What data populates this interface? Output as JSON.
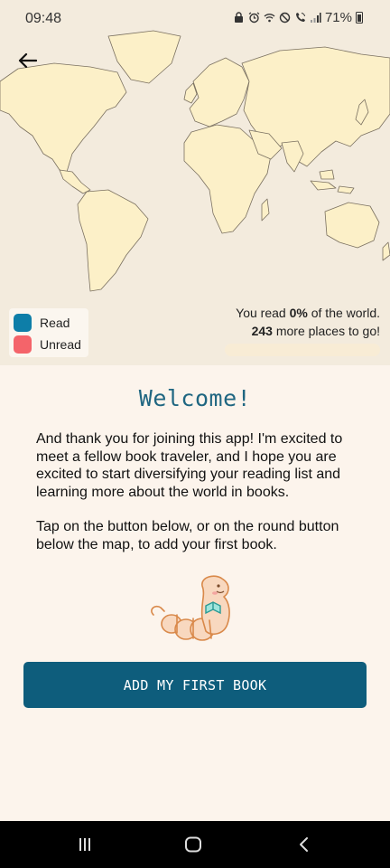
{
  "status_bar": {
    "time": "09:48",
    "battery": "71%",
    "icons": [
      "lock-icon",
      "alarm-icon",
      "wifi-icon",
      "do-not-disturb-icon",
      "wifi-call-icon",
      "signal-icon",
      "battery-icon"
    ]
  },
  "map": {
    "back_icon": "arrow-left-icon",
    "legend": [
      {
        "label": "Read",
        "color": "#0e7ea8"
      },
      {
        "label": "Unread",
        "color": "#f4646a"
      }
    ],
    "progress": {
      "prefix": "You read ",
      "percent": "0%",
      "suffix": " of the world.",
      "count": "243",
      "count_suffix": " more places to go!",
      "fraction": 0
    }
  },
  "welcome": {
    "title": "Welcome!",
    "paragraph1": "And thank you for joining this app! I'm excited to meet a fellow book traveler, and I hope you are excited to start diversifying your reading list and learning more about the world in books.",
    "paragraph2": "Tap on the button below, or on the round button below the map, to add your first book.",
    "button_label": "ADD MY FIRST BOOK"
  },
  "nav_bar": {
    "icons": [
      "recent-apps-icon",
      "home-icon",
      "back-icon"
    ]
  },
  "colors": {
    "accent": "#0e5d7c",
    "background": "#fcf4ec",
    "map_land": "#fcf0c8",
    "map_ocean": "#f3ebdd"
  }
}
